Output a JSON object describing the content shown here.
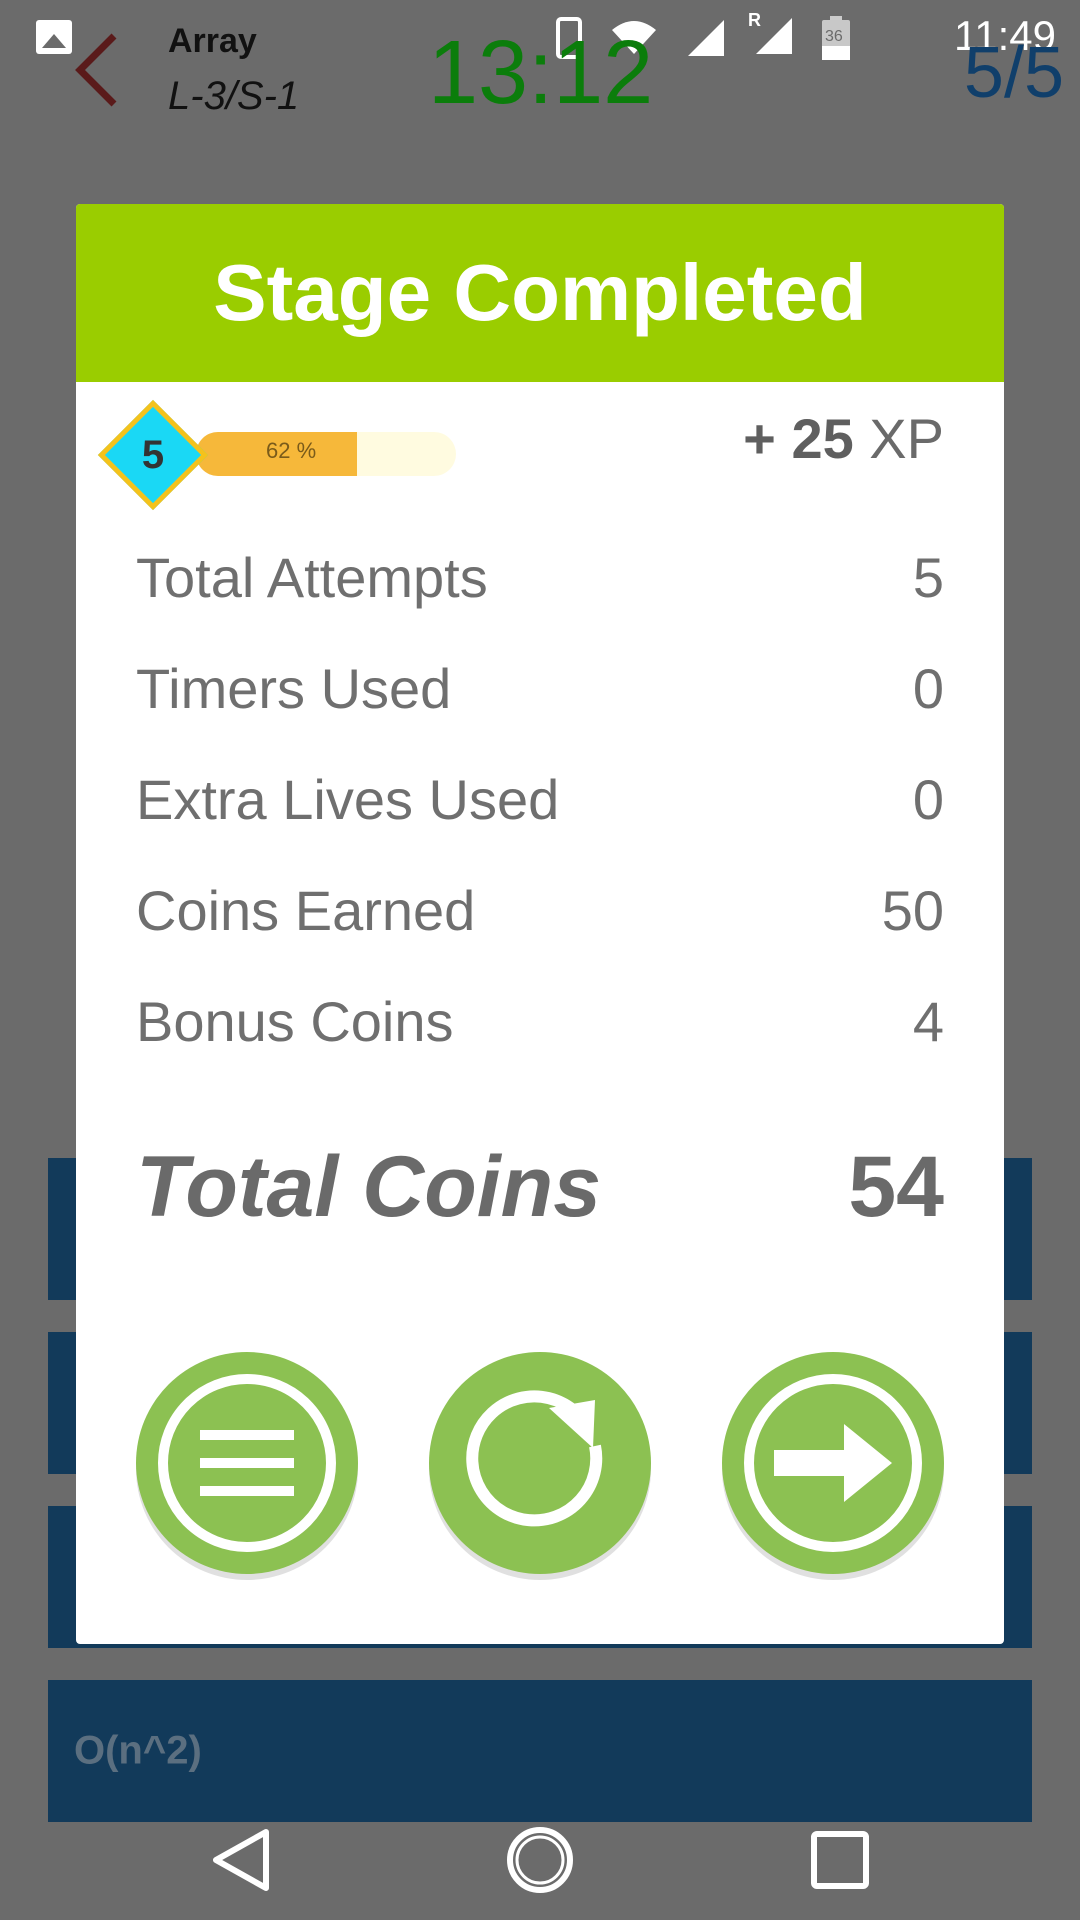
{
  "status_bar": {
    "time": "11:49",
    "battery_text": "36",
    "roaming_label": "R"
  },
  "app_header": {
    "title": "Array",
    "subtitle": "L-3/S-1",
    "timer": "13:12",
    "progress": "5/5"
  },
  "background_options": [
    {
      "label": ""
    },
    {
      "label": ""
    },
    {
      "label": ""
    },
    {
      "label": "O(n^2)"
    }
  ],
  "dialog": {
    "title": "Stage Completed",
    "level": {
      "number": "5",
      "percent_text": "62 %",
      "progress_fraction": 0.62
    },
    "xp": {
      "prefix": "+",
      "amount": "25",
      "unit": "XP"
    },
    "stats": [
      {
        "label": "Total Attempts",
        "value": "5"
      },
      {
        "label": "Timers Used",
        "value": "0"
      },
      {
        "label": "Extra Lives Used",
        "value": "0"
      },
      {
        "label": "Coins Earned",
        "value": "50"
      },
      {
        "label": "Bonus Coins",
        "value": "4"
      }
    ],
    "total": {
      "label": "Total Coins",
      "value": "54"
    },
    "buttons": [
      {
        "icon": "menu-icon"
      },
      {
        "icon": "replay-icon"
      },
      {
        "icon": "next-arrow-icon"
      }
    ]
  },
  "colors": {
    "header_green": "#9acd00",
    "button_green": "#8cc152",
    "timer_green": "#0b7d0b",
    "level_fill": "#f6b83a",
    "diamond_blue": "#1ad8f5"
  }
}
